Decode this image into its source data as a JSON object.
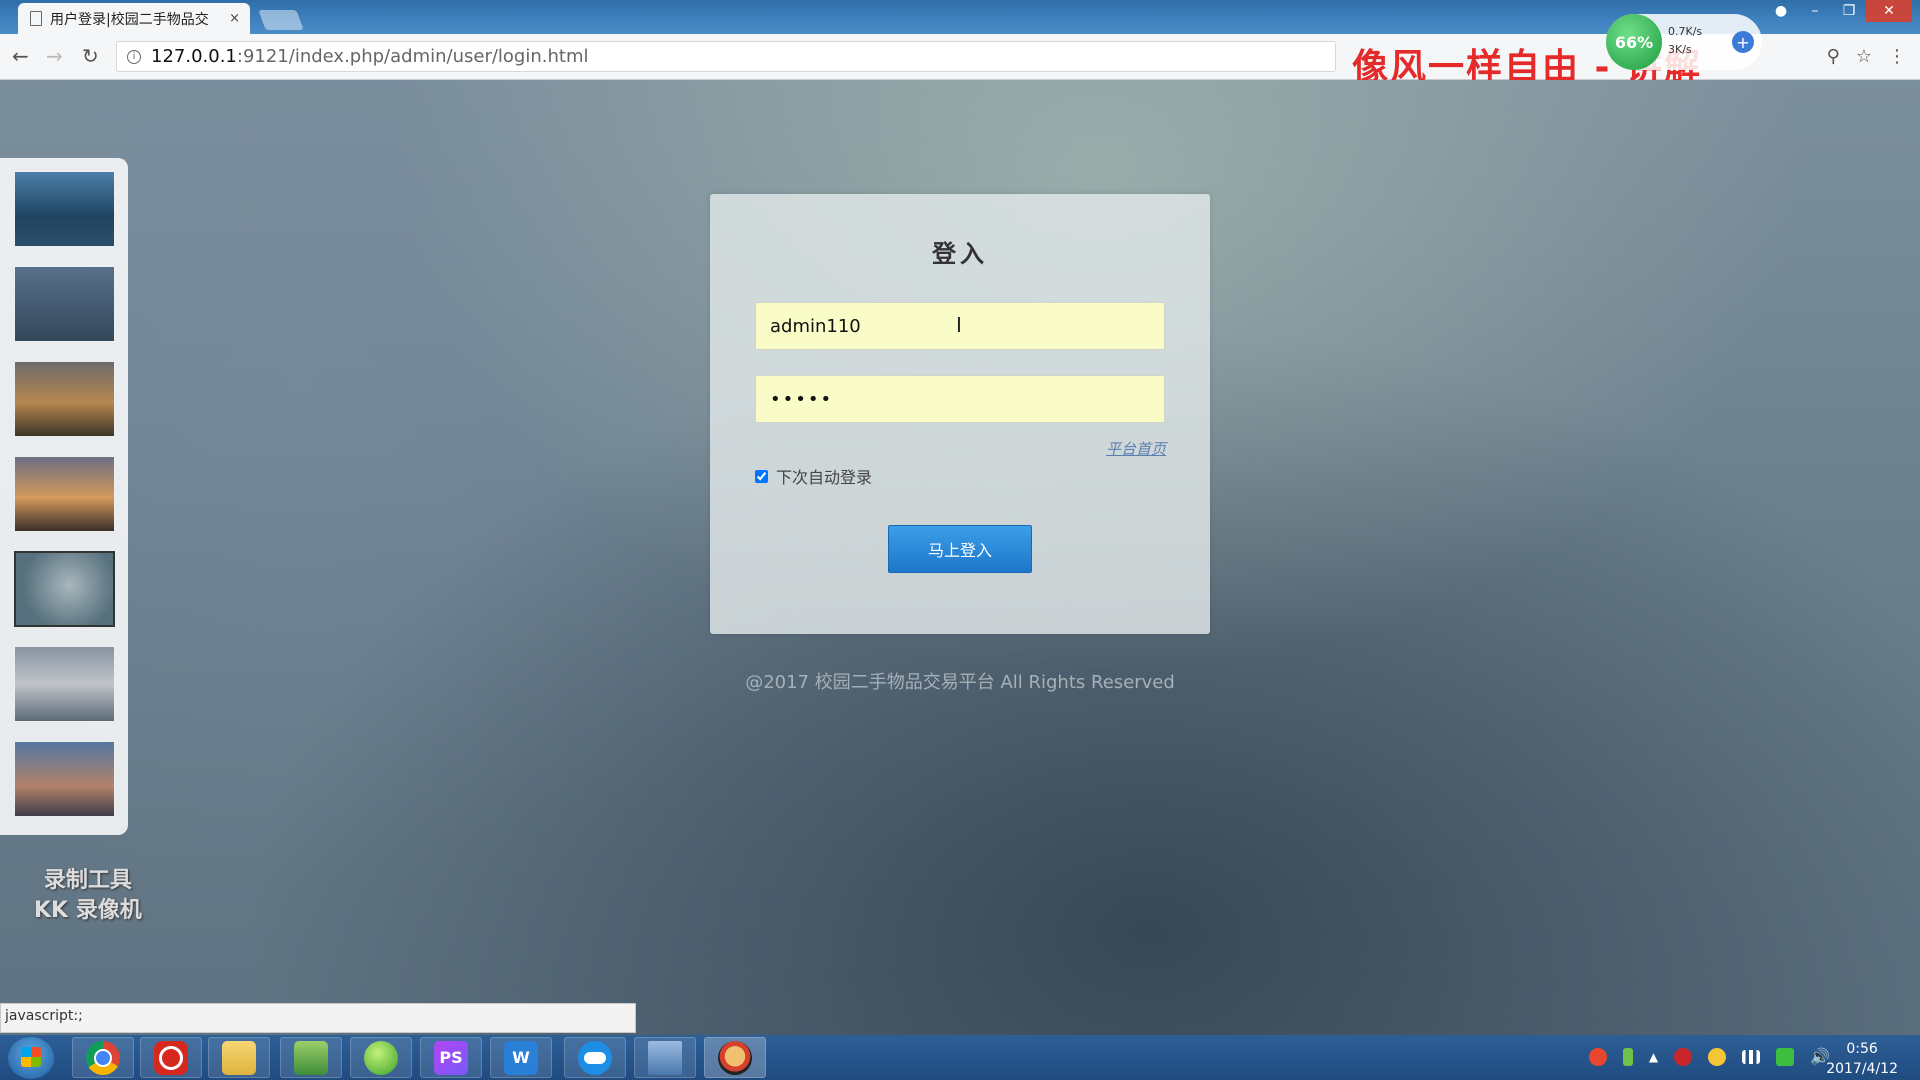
{
  "browser": {
    "tab_title": "用户登录|校园二手物品交",
    "tab_close": "×",
    "url_host": "127.0.0.1",
    "url_path": ":9121/index.php/admin/user/login.html",
    "overlay_text": "像风一样自由 - 讲解",
    "speed_percent": "66%",
    "speed_up": "0.7K/s",
    "speed_down": "3K/s"
  },
  "login": {
    "title": "登入",
    "username_value": "admin110",
    "password_value": "•••••",
    "home_link": "平台首页",
    "remember_label": "下次自动登录",
    "remember_checked": true,
    "submit_label": "马上登入"
  },
  "footer": {
    "copyright": "@2017 校园二手物品交易平台 All Rights Reserved"
  },
  "watermark": {
    "line1": "录制工具",
    "line2": "KK 录像机"
  },
  "status_bar": {
    "text": "javascript:;"
  },
  "taskbar": {
    "time": "0:56",
    "date": "2017/4/12",
    "apps": [
      "chrome-icon",
      "netease-music-icon",
      "file-explorer-icon",
      "editor-icon",
      "leaf-app-icon",
      "phpstorm-icon",
      "word-icon",
      "cloud-icon",
      "window-icon",
      "avatar-app-icon"
    ],
    "phpstorm_label": "PS",
    "word_label": "W"
  },
  "colors": {
    "accent": "#1c76c9",
    "input_fill": "#fafcc8",
    "overlay_red": "#e52a2a"
  }
}
